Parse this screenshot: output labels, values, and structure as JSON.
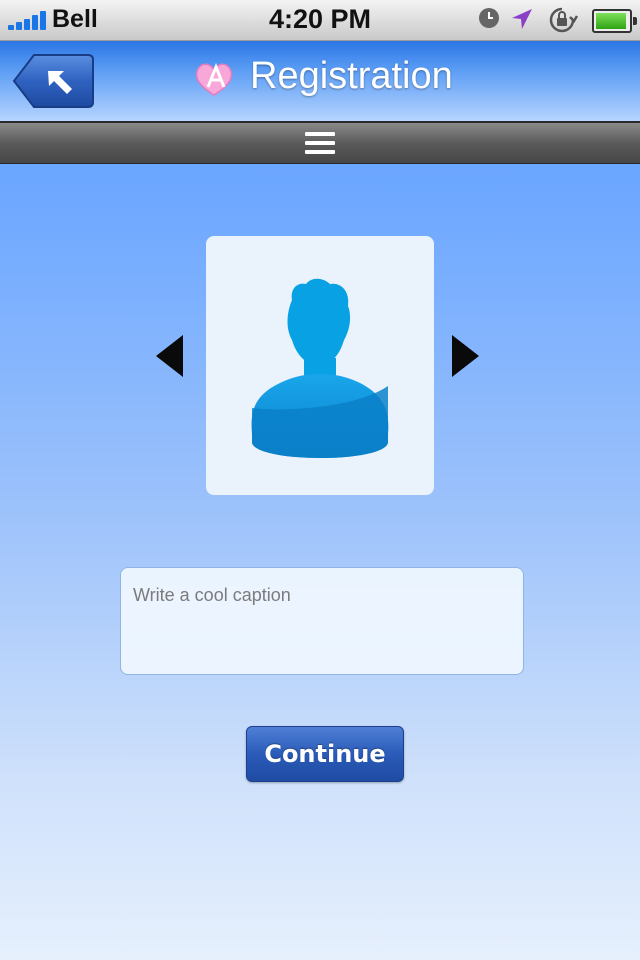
{
  "status_bar": {
    "carrier": "Bell",
    "time": "4:20 PM",
    "icons": [
      "signal-icon",
      "clock-icon",
      "location-icon",
      "rotation-lock-icon",
      "battery-icon"
    ]
  },
  "nav_bar": {
    "title": "Registration",
    "back_icon": "back-arrow-icon",
    "logo_icon": "app-logo-icon"
  },
  "menu_bar": {
    "icon": "hamburger-menu-icon"
  },
  "avatar": {
    "icon": "user-silhouette-icon",
    "prev_icon": "arrow-left-icon",
    "next_icon": "arrow-right-icon"
  },
  "caption": {
    "placeholder": "Write a cool caption",
    "value": ""
  },
  "actions": {
    "continue_label": "Continue"
  },
  "colors": {
    "accent": "#2a5bb8",
    "avatar_blue": "#0a9ae6"
  }
}
